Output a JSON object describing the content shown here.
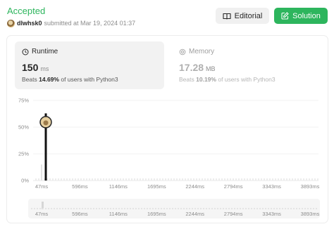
{
  "status": {
    "label": "Accepted",
    "color": "#2db55d"
  },
  "submission": {
    "user": "dlwhsk0",
    "text": "submitted at Mar 19, 2024 01:37"
  },
  "buttons": {
    "editorial": "Editorial",
    "solution": "Solution"
  },
  "runtime": {
    "title": "Runtime",
    "value": "150",
    "unit": "ms",
    "beats_prefix": "Beats",
    "beats_value": "14.69%",
    "beats_suffix": "of users with Python3"
  },
  "memory": {
    "title": "Memory",
    "value": "17.28",
    "unit": "MB",
    "beats_prefix": "Beats",
    "beats_value": "10.19%",
    "beats_suffix": "of users with Python3"
  },
  "chart_data": {
    "type": "bar",
    "y_ticks": [
      "75%",
      "50%",
      "25%",
      "0%"
    ],
    "ylim": [
      0,
      75
    ],
    "x_ticks": [
      "47ms",
      "596ms",
      "1146ms",
      "1695ms",
      "2244ms",
      "2794ms",
      "3343ms",
      "3893ms"
    ],
    "selected_x": "47ms",
    "selected_value": 55,
    "grid": true
  },
  "minimap": {
    "x_ticks": [
      "47ms",
      "596ms",
      "1146ms",
      "1695ms",
      "2244ms",
      "2794ms",
      "3343ms",
      "3893ms"
    ]
  }
}
